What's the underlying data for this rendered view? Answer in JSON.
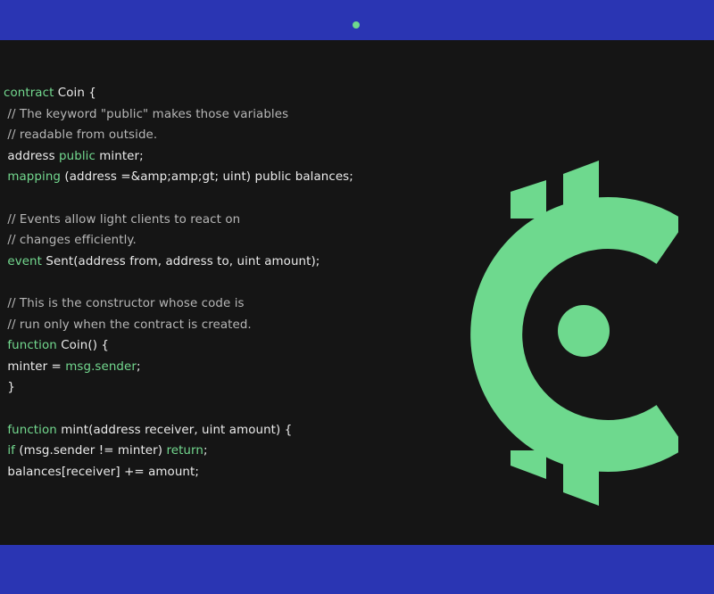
{
  "colors": {
    "bezel": "#2a35b3",
    "background": "#151515",
    "code_text": "#ececec",
    "keyword": "#73d98f",
    "comment": "#b7b7b7",
    "logo": "#6ed98e"
  },
  "logo_icon": "coin-c-logo-icon",
  "code": {
    "lines": [
      [
        {
          "t": "contract",
          "k": "kw"
        },
        {
          "t": " Coin {",
          "k": "tx"
        }
      ],
      [
        {
          "t": " // The keyword \"public\" makes those variables",
          "k": "cm"
        }
      ],
      [
        {
          "t": " // readable from outside.",
          "k": "cm"
        }
      ],
      [
        {
          "t": " address ",
          "k": "tx"
        },
        {
          "t": "public",
          "k": "kw"
        },
        {
          "t": " minter;",
          "k": "tx"
        }
      ],
      [
        {
          "t": " mapping",
          "k": "kw"
        },
        {
          "t": " (address =&amp;amp;gt; uint) public balances;",
          "k": "tx"
        }
      ],
      [],
      [
        {
          "t": " // Events allow light clients to react on",
          "k": "cm"
        }
      ],
      [
        {
          "t": " // changes efficiently.",
          "k": "cm"
        }
      ],
      [
        {
          "t": " event",
          "k": "kw"
        },
        {
          "t": " Sent(address from, address to, uint amount);",
          "k": "tx"
        }
      ],
      [],
      [
        {
          "t": " // This is the constructor whose code is",
          "k": "cm"
        }
      ],
      [
        {
          "t": " // run only when the contract is created.",
          "k": "cm"
        }
      ],
      [
        {
          "t": " function",
          "k": "kw"
        },
        {
          "t": " Coin() {",
          "k": "tx"
        }
      ],
      [
        {
          "t": " minter = ",
          "k": "tx"
        },
        {
          "t": "msg.sender",
          "k": "kw"
        },
        {
          "t": ";",
          "k": "tx"
        }
      ],
      [
        {
          "t": " }",
          "k": "tx"
        }
      ],
      [],
      [
        {
          "t": " function",
          "k": "kw"
        },
        {
          "t": " mint(address receiver, uint amount) {",
          "k": "tx"
        }
      ],
      [
        {
          "t": " if",
          "k": "kw"
        },
        {
          "t": " (msg.sender != minter) ",
          "k": "tx"
        },
        {
          "t": "return",
          "k": "kw"
        },
        {
          "t": ";",
          "k": "tx"
        }
      ],
      [
        {
          "t": " balances[receiver] += amount;",
          "k": "tx"
        }
      ]
    ]
  }
}
